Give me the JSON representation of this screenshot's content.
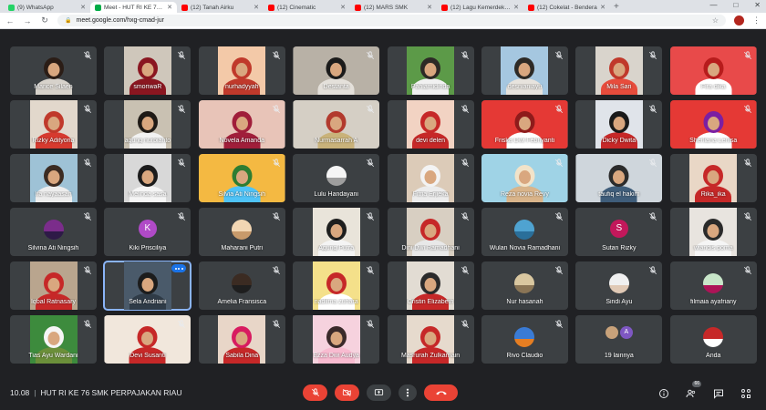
{
  "browser": {
    "tabs": [
      {
        "title": "(9) WhatsApp",
        "color": "#25d366",
        "active": false
      },
      {
        "title": "Meet - HUT RI KE 76 SMK",
        "color": "#00ac47",
        "active": true
      },
      {
        "title": "(12) Tanah Airku",
        "color": "#ff0000",
        "active": false
      },
      {
        "title": "(12) Cinematic",
        "color": "#ff0000",
        "active": false
      },
      {
        "title": "(12) MARS SMK",
        "color": "#ff0000",
        "active": false
      },
      {
        "title": "(12) Lagu Kemerdekaan",
        "color": "#ff0000",
        "active": false
      },
      {
        "title": "(12) Cokelat - Bendera",
        "color": "#ff0000",
        "active": false
      }
    ],
    "new_tab": "+",
    "url": "meet.google.com/hxg-cmad-jur"
  },
  "participants": [
    {
      "name": "Marice Silaen",
      "kind": "video",
      "bg": "#3c4043",
      "hair": "#2b1d16",
      "cloth": "#d7d2cb"
    },
    {
      "name": "smoriwaR",
      "kind": "video",
      "bg": "#cfc7bb",
      "hair": "#8a1620",
      "cloth": "#8a1620"
    },
    {
      "name": "nurhadyyah",
      "kind": "video",
      "bg": "#f3c9a8",
      "hair": "#c0392b",
      "cloth": "#c0392b"
    },
    {
      "name": "Destanta",
      "kind": "video",
      "bg": "#b8b1a6",
      "hair": "#1b1b1b",
      "cloth": "#e4e0da",
      "wide": true
    },
    {
      "name": "Pahlamidinda",
      "kind": "video",
      "bg": "#5c9a48",
      "hair": "#2d2a26",
      "cloth": "#f1f1f1"
    },
    {
      "name": "desnianiayu",
      "kind": "video",
      "bg": "#a5c7e0",
      "hair": "#2d2a26",
      "cloth": "#e7e3dd"
    },
    {
      "name": "Mila Sari",
      "kind": "video",
      "bg": "#d9d4cc",
      "hair": "#c0392b",
      "cloth": "#e74c3c"
    },
    {
      "name": "Fira dika",
      "kind": "video",
      "bg": "#e84a4a",
      "hair": "#b71c1c",
      "cloth": "#ffffff",
      "wide": true
    },
    {
      "name": "Rizky Adityona",
      "kind": "video",
      "bg": "#e2d8cc",
      "hair": "#c0392b",
      "cloth": "#d63a2f"
    },
    {
      "name": "agung nurbianto",
      "kind": "video",
      "bg": "#c9c1b2",
      "hair": "#1f1a16",
      "cloth": "#f2f2f2"
    },
    {
      "name": "Novela Amanda",
      "kind": "video",
      "bg": "#e8c4b8",
      "hair": "#a01e3a",
      "cloth": "#a01e3a",
      "wide": true
    },
    {
      "name": "Nurmasarrah A",
      "kind": "video",
      "bg": "#d5cfc5",
      "hair": "#b23a2e",
      "cloth": "#c9b27a",
      "wide": true
    },
    {
      "name": "devi delen",
      "kind": "video",
      "bg": "#f2d3c3",
      "hair": "#c62828",
      "cloth": "#c62828"
    },
    {
      "name": "Friska Dwi Febriyanti",
      "kind": "video",
      "bg": "#e53935",
      "hair": "#8e1b1b",
      "cloth": "#ffffff",
      "wide": true
    },
    {
      "name": "Dicky Dwita",
      "kind": "video",
      "bg": "#e0e4ea",
      "hair": "#1a1a1a",
      "cloth": "#c62828"
    },
    {
      "name": "Sherliana Lenisa",
      "kind": "video",
      "bg": "#e53935",
      "hair": "#7b1fa2",
      "cloth": "#ffffff",
      "wide": true
    },
    {
      "name": "Ifa nayaasari",
      "kind": "video",
      "bg": "#9ec2d6",
      "hair": "#3b2b22",
      "cloth": "#ededed"
    },
    {
      "name": "Melinda sasa",
      "kind": "video",
      "bg": "#d8d8d8",
      "hair": "#1b1b1b",
      "cloth": "#f5f5f5"
    },
    {
      "name": "Silvia Ati Ningsih",
      "kind": "video",
      "bg": "#f4b942",
      "hair": "#2e7d32",
      "cloth": "#4fc3f7",
      "wide": true
    },
    {
      "name": "Lulu Handayani",
      "kind": "avatar",
      "c1": "#f5f5f5",
      "c2": "#9e9e9e"
    },
    {
      "name": "Fitria Erjieka",
      "kind": "video",
      "bg": "#dccbb8",
      "hair": "#f3f3f3",
      "cloth": "#ececec"
    },
    {
      "name": "Reza novia Revy",
      "kind": "video",
      "bg": "#9fd3e6",
      "hair": "#f2e3c9",
      "cloth": "#d9b48a",
      "wide": true
    },
    {
      "name": "taufiq el hakim",
      "kind": "video",
      "bg": "#cfd6dc",
      "hair": "#2b2b2b",
      "cloth": "#3f5d7a",
      "wide": true
    },
    {
      "name": "Rika_ika",
      "kind": "video",
      "bg": "#e9d7c6",
      "hair": "#c62828",
      "cloth": "#c62828"
    },
    {
      "name": "Silvina Ati Ningsih",
      "kind": "avatar",
      "c1": "#7b2d8b",
      "c2": "#2e1a47"
    },
    {
      "name": "Kiki Prisciliya",
      "kind": "letter",
      "letter": "K",
      "color": "#b04ac7"
    },
    {
      "name": "Maharani Putri",
      "kind": "avatar",
      "c1": "#f2d6b3",
      "c2": "#c79a6b"
    },
    {
      "name": "Agung Putra",
      "kind": "video",
      "bg": "#e9e4da",
      "hair": "#1e1e1e",
      "cloth": "#f4f4f4"
    },
    {
      "name": "Dini Dwi Ramadhani",
      "kind": "video",
      "bg": "#d8cfc2",
      "hair": "#c62828",
      "cloth": "#e8e8e8"
    },
    {
      "name": "Wulan Novia Ramadhani",
      "kind": "avatar",
      "c1": "#4fa3d1",
      "c2": "#2a6f9a"
    },
    {
      "name": "Sutan Rizky",
      "kind": "letter",
      "letter": "S",
      "color": "#c2185b"
    },
    {
      "name": "wiandis poma",
      "kind": "video",
      "bg": "#e8e4df",
      "hair": "#2a2a2a",
      "cloth": "#f5f5f5"
    },
    {
      "name": "Iqbal Ratnasary",
      "kind": "video",
      "bg": "#b9a58e",
      "hair": "#c62828",
      "cloth": "#c62828"
    },
    {
      "name": "Sela Andriani",
      "kind": "video",
      "bg": "#4a5a6a",
      "hair": "#1c1c1c",
      "cloth": "#2f3b47",
      "selected": true
    },
    {
      "name": "Amelia Fransisca",
      "kind": "avatar",
      "c1": "#3b2b22",
      "c2": "#1e1e1e"
    },
    {
      "name": "nadiima zuhara",
      "kind": "video",
      "bg": "#f4e08a",
      "hair": "#c62828",
      "cloth": "#ffffff"
    },
    {
      "name": "Cristin Elizabeth",
      "kind": "video",
      "bg": "#e2dcd3",
      "hair": "#2b2b2b",
      "cloth": "#c62828"
    },
    {
      "name": "Nur hasanah",
      "kind": "avatar",
      "c1": "#d9c7a0",
      "c2": "#8a7556"
    },
    {
      "name": "Sindi Ayu",
      "kind": "avatar",
      "c1": "#f0f0f0",
      "c2": "#e0c9b5"
    },
    {
      "name": "filmaia ayafriany",
      "kind": "avatar",
      "c1": "#c8e6c9",
      "c2": "#ad1457"
    },
    {
      "name": "Tias Ayu Wardani",
      "kind": "video",
      "bg": "#3d8b3d",
      "hair": "#f5f5f5",
      "cloth": "#6b8f3a"
    },
    {
      "name": "Devi Susanti",
      "kind": "video",
      "bg": "#f1e7dc",
      "hair": "#c62828",
      "cloth": "#c62828",
      "wide": true
    },
    {
      "name": "Sabila Dina",
      "kind": "video",
      "bg": "#e8d6c8",
      "hair": "#d81b60",
      "cloth": "#c62828"
    },
    {
      "name": "Ezza Dwi Audya",
      "kind": "video",
      "bg": "#f6d2de",
      "hair": "#3a2a2a",
      "cloth": "#f8bbd0"
    },
    {
      "name": "Masrurah Zulkarnain",
      "kind": "video",
      "bg": "#e6dacd",
      "hair": "#c62828",
      "cloth": "#c62828"
    },
    {
      "name": "Rivo Claudio",
      "kind": "avatar",
      "c1": "#3a7bd5",
      "c2": "#e67e22"
    },
    {
      "name": "19 lainnya",
      "kind": "overflow"
    },
    {
      "name": "Anda",
      "kind": "avatar",
      "c1": "#c62828",
      "c2": "#ffffff"
    }
  ],
  "bottom": {
    "time": "10.08",
    "meeting_title": "HUT RI KE 76 SMK PERPAJAKAN RIAU",
    "participants_count": "66"
  },
  "colors": {
    "background": "#202124",
    "tile": "#3c4043",
    "danger": "#ea4335",
    "accent": "#8ab4f8"
  }
}
